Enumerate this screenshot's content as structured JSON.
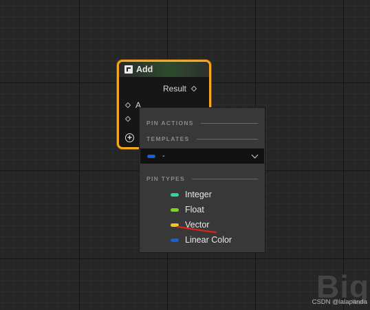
{
  "node": {
    "title": "Add",
    "output_pin": "Result",
    "input_pins": [
      "A",
      ""
    ]
  },
  "menu": {
    "section_pin_actions": "PIN ACTIONS",
    "section_templates": "TEMPLATES",
    "template_value": "-",
    "template_color": "#1a5fd6",
    "section_pin_types": "PIN TYPES",
    "types": [
      {
        "label": "Integer",
        "color": "#2ed6a2"
      },
      {
        "label": "Float",
        "color": "#7ad81c"
      },
      {
        "label": "Vector",
        "color": "#f2c61d"
      },
      {
        "label": "Linear Color",
        "color": "#1a5fd6"
      }
    ]
  },
  "annotation_color": "#e0241b",
  "watermark_big": "Big",
  "watermark": "CSDN @lalapanda"
}
